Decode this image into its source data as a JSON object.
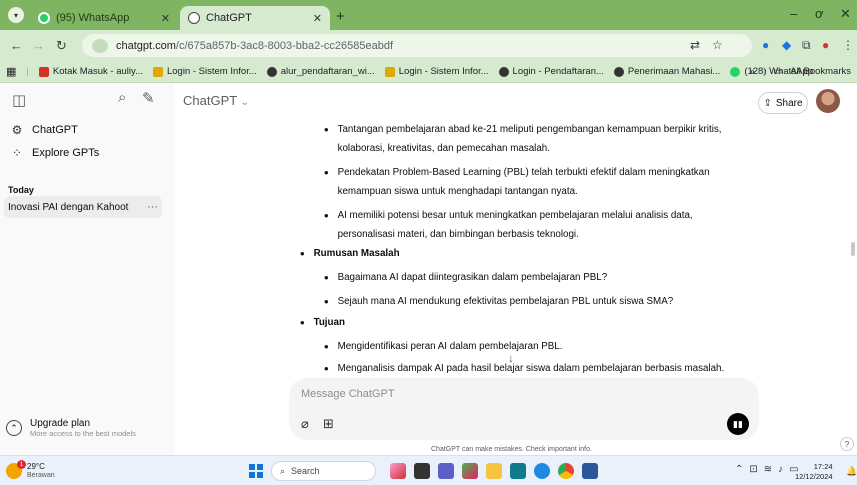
{
  "browser": {
    "tabs": [
      {
        "label": "(95) WhatsApp",
        "active": false
      },
      {
        "label": "ChatGPT",
        "active": true
      }
    ],
    "new_tab_label": "+",
    "window_controls": {
      "minimize": "–",
      "restore": "ơ",
      "close": "✕"
    },
    "url_host": "chatgpt.com",
    "url_path": "/c/675a857b-3ac8-8003-bba2-cc26585eabdf",
    "bookmarks": [
      {
        "label": "Kotak Masuk - auliy...",
        "color": "#d93025"
      },
      {
        "label": "Login - Sistem Infor...",
        "color": "#e0a800"
      },
      {
        "label": "alur_pendaftaran_wi...",
        "color": "#333333"
      },
      {
        "label": "Login - Sistem Infor...",
        "color": "#e0a800"
      },
      {
        "label": "Login - Pendaftaran...",
        "color": "#333333"
      },
      {
        "label": "Penerimaan Mahasi...",
        "color": "#333333"
      },
      {
        "label": "(128) WhatsApp",
        "color": "#25d366"
      }
    ],
    "bookmarks_overflow": "»",
    "all_bookmarks": "All Bookmarks"
  },
  "sidebar": {
    "items": [
      {
        "label": "ChatGPT",
        "icon": "openai-icon"
      },
      {
        "label": "Explore GPTs",
        "icon": "grid-icon"
      }
    ],
    "section": "Today",
    "conversations": [
      {
        "label": "Inovasi PAI dengan Kahoot",
        "menu": "···"
      }
    ],
    "upgrade_title": "Upgrade plan",
    "upgrade_subtitle": "More access to the best models"
  },
  "main": {
    "title": "ChatGPT",
    "title_chevron": "⌄",
    "share_label": "Share",
    "content": {
      "intro_bullets": [
        {
          "line1": "Tantangan pembelajaran abad ke-21 meliputi pengembangan kemampuan berpikir kritis,",
          "line2": "kolaborasi, kreativitas, dan pemecahan masalah."
        },
        {
          "line1": "Pendekatan Problem-Based Learning (PBL) telah terbukti efektif dalam meningkatkan",
          "line2": "kemampuan siswa untuk menghadapi tantangan nyata."
        },
        {
          "line1": "AI memiliki potensi besar untuk meningkatkan pembelajaran melalui analisis data,",
          "line2": "personalisasi materi, dan bimbingan berbasis teknologi."
        }
      ],
      "sections": [
        {
          "heading": "Rumusan Masalah",
          "items": [
            "Bagaimana AI dapat diintegrasikan dalam pembelajaran PBL?",
            "Sejauh mana AI mendukung efektivitas pembelajaran PBL untuk siswa SMA?"
          ]
        },
        {
          "heading": "Tujuan",
          "items": [
            "Mengidentifikasi peran AI dalam pembelajaran PBL.",
            "Menganalisis dampak AI pada hasil belajar siswa dalam pembelajaran berbasis masalah."
          ]
        }
      ]
    },
    "composer_placeholder": "Message ChatGPT",
    "disclaimer": "ChatGPT can make mistakes. Check important info.",
    "help": "?"
  },
  "taskbar": {
    "temperature": "29°C",
    "condition": "Berawan",
    "weather_badge": "1",
    "search_label": "Search",
    "time": "17:24",
    "date": "12/12/2024"
  }
}
